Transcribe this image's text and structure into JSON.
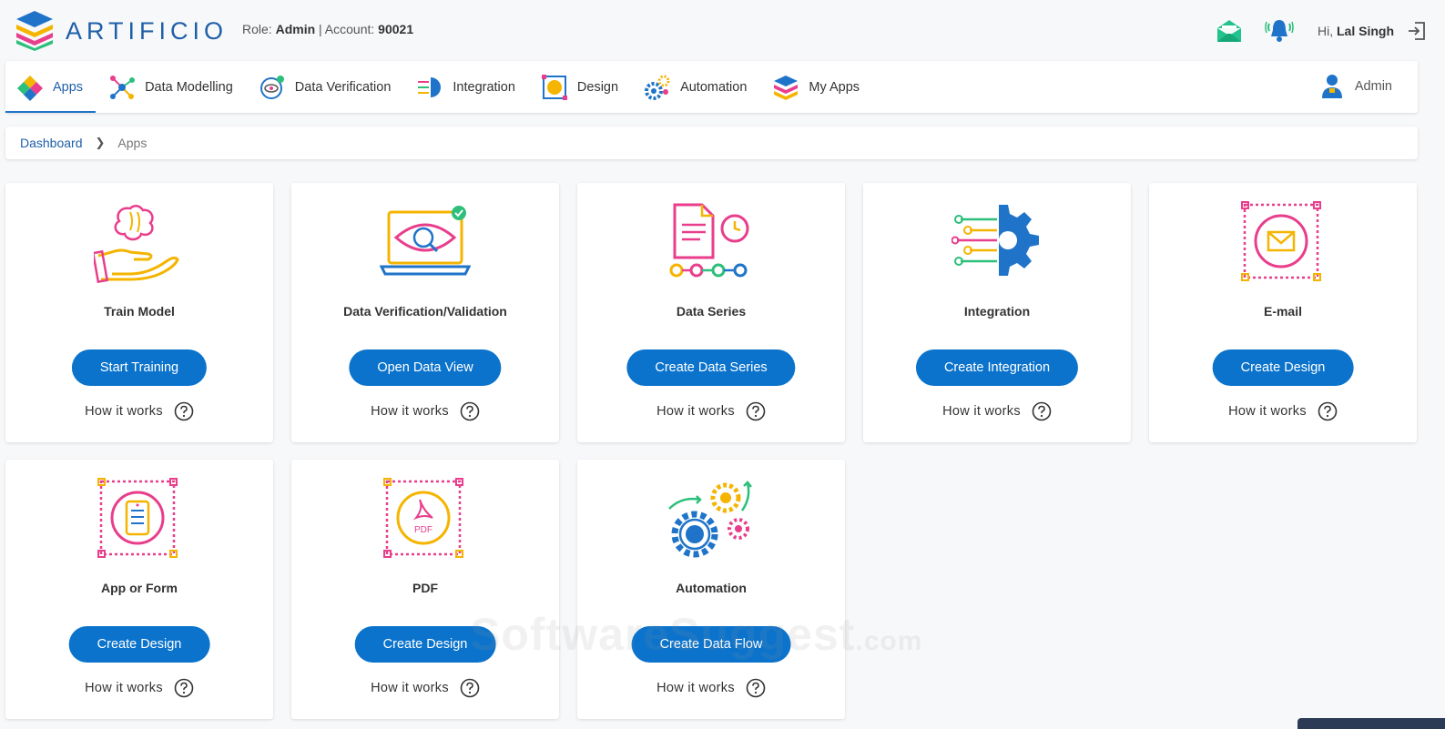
{
  "brand": {
    "name": "ARTIFICIO"
  },
  "role_info": {
    "role_label": "Role:",
    "role": "Admin",
    "separator": "|",
    "account_label": "Account:",
    "account": "90021"
  },
  "user": {
    "greeting": "Hi,",
    "name": "Lal Singh"
  },
  "nav": {
    "items": [
      {
        "label": "Apps",
        "icon": "apps-icon",
        "active": true
      },
      {
        "label": "Data Modelling",
        "icon": "data-modelling-icon"
      },
      {
        "label": "Data Verification",
        "icon": "data-verification-icon"
      },
      {
        "label": "Integration",
        "icon": "integration-icon"
      },
      {
        "label": "Design",
        "icon": "design-icon"
      },
      {
        "label": "Automation",
        "icon": "automation-icon"
      },
      {
        "label": "My Apps",
        "icon": "my-apps-icon"
      }
    ],
    "admin_label": "Admin"
  },
  "breadcrumb": {
    "root": "Dashboard",
    "current": "Apps"
  },
  "cards": [
    {
      "title": "Train Model",
      "button": "Start Training",
      "how": "How it works",
      "icon": "brain-hand-icon"
    },
    {
      "title": "Data Verification/Validation",
      "button": "Open Data View",
      "how": "How it works",
      "icon": "laptop-eye-icon"
    },
    {
      "title": "Data Series",
      "button": "Create Data Series",
      "how": "How it works",
      "icon": "document-clock-icon"
    },
    {
      "title": "Integration",
      "button": "Create Integration",
      "how": "How it works",
      "icon": "circuit-gear-icon"
    },
    {
      "title": "E-mail",
      "button": "Create Design",
      "how": "How it works",
      "icon": "envelope-frame-icon"
    },
    {
      "title": "App or Form",
      "button": "Create Design",
      "how": "How it works",
      "icon": "form-frame-icon"
    },
    {
      "title": "PDF",
      "button": "Create Design",
      "how": "How it works",
      "icon": "pdf-frame-icon"
    },
    {
      "title": "Automation",
      "button": "Create Data Flow",
      "how": "How it works",
      "icon": "gears-icon"
    }
  ],
  "watermark": {
    "text": "SoftwareSuggest",
    "suffix": ".com"
  },
  "colors": {
    "primary": "#0b73cc",
    "brand_text": "#1f5fa8",
    "background": "#f7f8fa"
  }
}
